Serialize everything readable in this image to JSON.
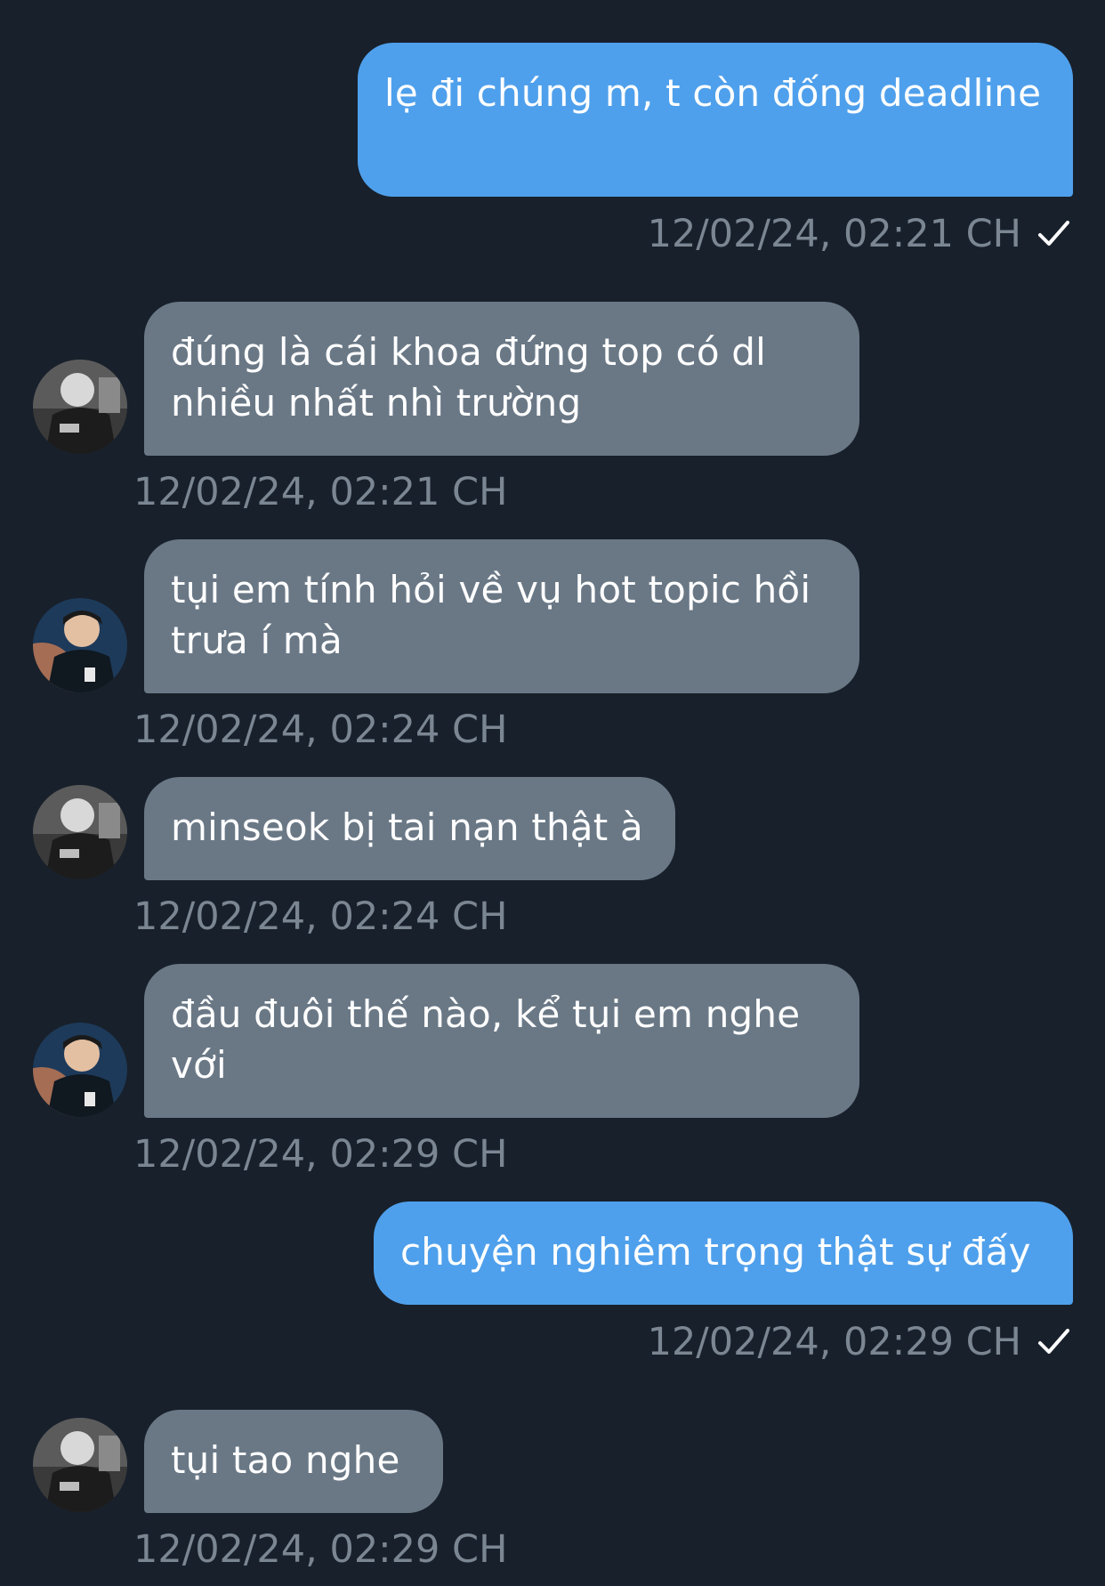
{
  "messages": [
    {
      "direction": "outgoing",
      "text": "lẹ đi chúng m, t còn đống deadline",
      "time": "12/02/24, 02:21 CH",
      "status_icon": "check-icon"
    },
    {
      "direction": "incoming",
      "avatar": "avatar-bw-player",
      "text": "đúng là cái khoa đứng top có dl nhiều nhất nhì trường",
      "time": "12/02/24, 02:21 CH"
    },
    {
      "direction": "incoming",
      "avatar": "avatar-color-player",
      "text": "tụi em tính hỏi về vụ hot topic hồi trưa í mà",
      "time": "12/02/24, 02:24 CH"
    },
    {
      "direction": "incoming",
      "avatar": "avatar-bw-player",
      "text": "minseok bị tai nạn thật à",
      "time": "12/02/24, 02:24 CH"
    },
    {
      "direction": "incoming",
      "avatar": "avatar-color-player",
      "text": "đầu đuôi thế nào, kể tụi em nghe với",
      "time": "12/02/24, 02:29 CH"
    },
    {
      "direction": "outgoing",
      "text": "chuyện nghiêm trọng thật sự đấy",
      "time": "12/02/24, 02:29 CH",
      "status_icon": "check-icon"
    },
    {
      "direction": "incoming",
      "avatar": "avatar-bw-player",
      "text": "tụi tao nghe",
      "time": "12/02/24, 02:29 CH"
    }
  ],
  "colors": {
    "background": "#18202b",
    "outgoing_bubble": "#4fa0ec",
    "incoming_bubble": "#6a7886",
    "timestamp": "#7b8693"
  }
}
